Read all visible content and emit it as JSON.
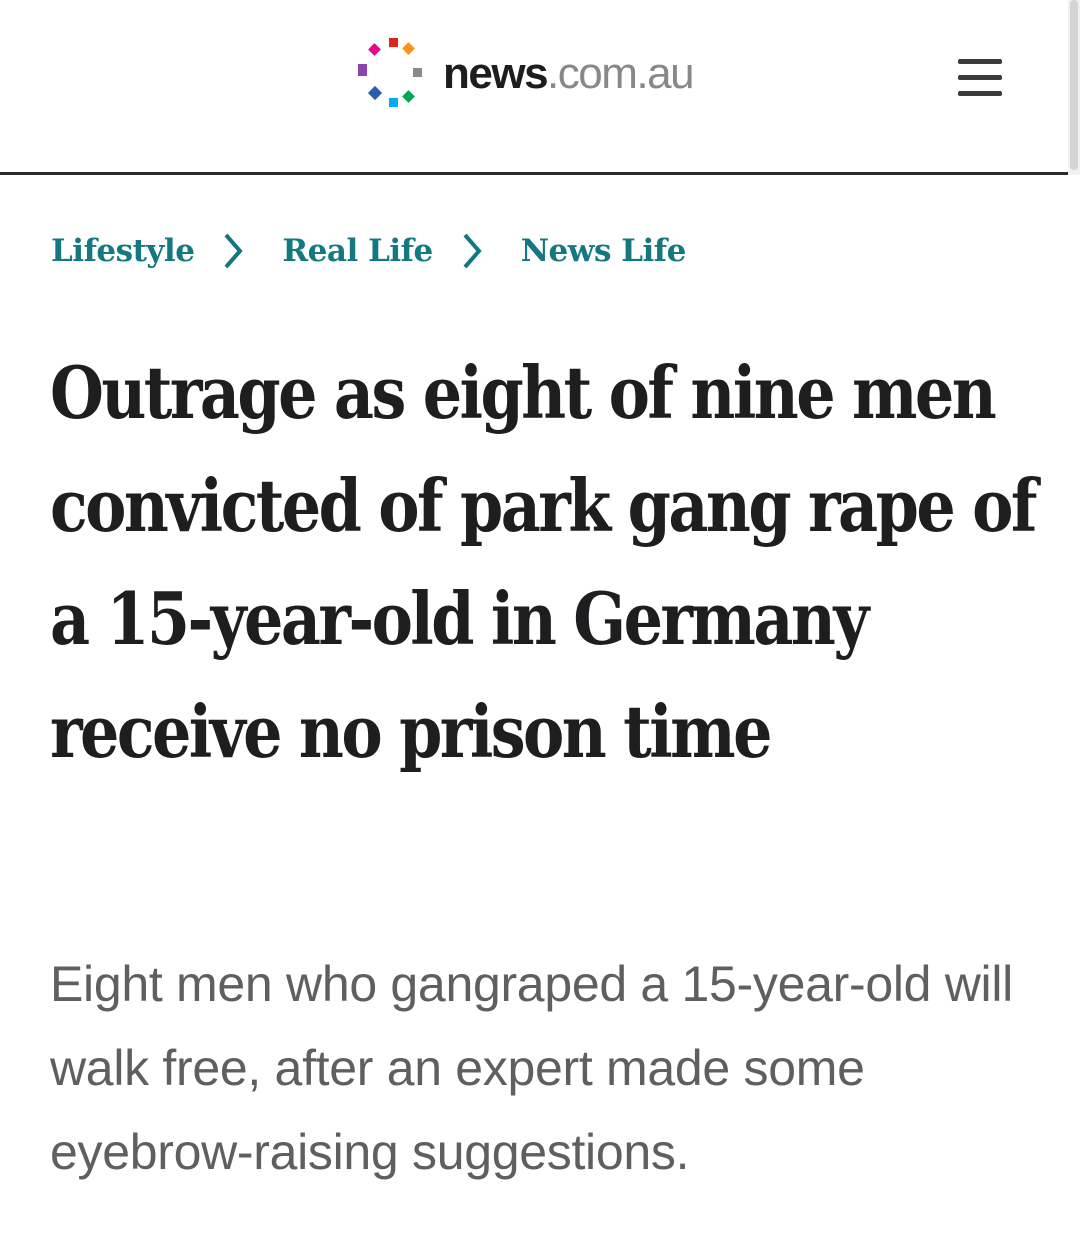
{
  "header": {
    "logo": {
      "icon": "news-pinwheel-logo-icon",
      "brand": "news",
      "domain": ".com.au",
      "colors": [
        "#e2231a",
        "#f7931e",
        "#8dc63f",
        "#00a651",
        "#00aeef",
        "#2e5da8",
        "#8e44ad",
        "#ec008c",
        "#8a8a8a"
      ]
    },
    "menu_icon": "hamburger-menu-icon"
  },
  "breadcrumb": {
    "items": [
      {
        "label": "Lifestyle"
      },
      {
        "label": "Real Life"
      },
      {
        "label": "News Life"
      }
    ],
    "separator_icon": "chevron-right-icon",
    "color": "#13787f"
  },
  "article": {
    "headline": "Outrage as eight of nine men convicted of park gang rape of a 15-year-old in Germany receive no prison time",
    "standfirst": "Eight men who gangraped a 15-year-old will walk free, after an expert made some eyebrow-raising suggestions."
  }
}
